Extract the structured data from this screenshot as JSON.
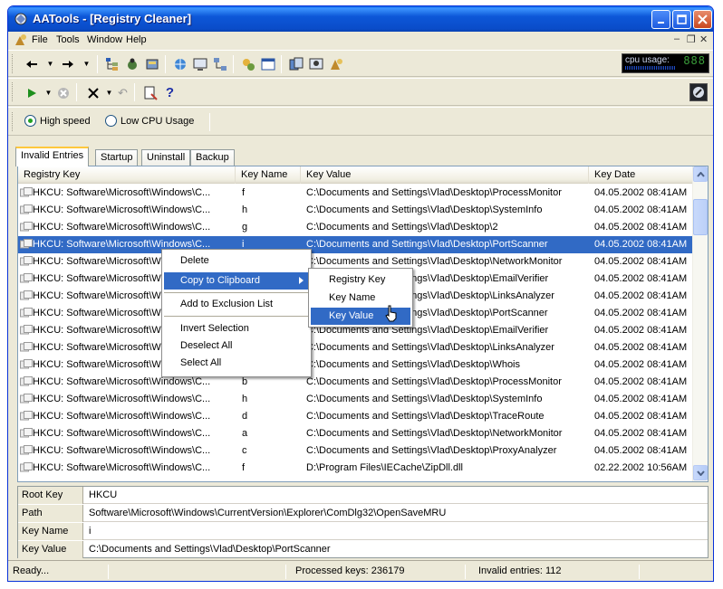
{
  "window": {
    "title": "AATools - [Registry Cleaner]"
  },
  "menu": [
    "File",
    "Tools",
    "Window",
    "Help"
  ],
  "cpu": {
    "label": "cpu usage:",
    "digits": "888"
  },
  "options": {
    "high_speed": "High speed",
    "low_cpu": "Low CPU Usage",
    "selected": "high_speed"
  },
  "tabs": [
    "Invalid Entries",
    "Startup",
    "Uninstall",
    "Backup"
  ],
  "columns": [
    "Registry Key",
    "Key Name",
    "Key Value",
    "Key Date"
  ],
  "rows": [
    {
      "key": "HKCU: Software\\Microsoft\\Windows\\C...",
      "name": "f",
      "value": "C:\\Documents and Settings\\Vlad\\Desktop\\ProcessMonitor",
      "date": "04.05.2002 08:41AM"
    },
    {
      "key": "HKCU: Software\\Microsoft\\Windows\\C...",
      "name": "h",
      "value": "C:\\Documents and Settings\\Vlad\\Desktop\\SystemInfo",
      "date": "04.05.2002 08:41AM"
    },
    {
      "key": "HKCU: Software\\Microsoft\\Windows\\C...",
      "name": "g",
      "value": "C:\\Documents and Settings\\Vlad\\Desktop\\2",
      "date": "04.05.2002 08:41AM"
    },
    {
      "key": "HKCU: Software\\Microsoft\\Windows\\C...",
      "name": "i",
      "value": "C:\\Documents and Settings\\Vlad\\Desktop\\PortScanner",
      "date": "04.05.2002 08:41AM"
    },
    {
      "key": "HKCU: Software\\Microsoft\\Windows\\C...",
      "name": "",
      "value": "C:\\Documents and Settings\\Vlad\\Desktop\\NetworkMonitor",
      "date": "04.05.2002 08:41AM"
    },
    {
      "key": "HKCU: Software\\Microsoft\\Windows\\C...",
      "name": "",
      "value": "C:\\Documents and Settings\\Vlad\\Desktop\\EmailVerifier",
      "date": "04.05.2002 08:41AM"
    },
    {
      "key": "HKCU: Software\\Microsoft\\Windows\\C...",
      "name": "",
      "value": "C:\\Documents and Settings\\Vlad\\Desktop\\LinksAnalyzer",
      "date": "04.05.2002 08:41AM"
    },
    {
      "key": "HKCU: Software\\Microsoft\\Windows\\C...",
      "name": "",
      "value": "C:\\Documents and Settings\\Vlad\\Desktop\\PortScanner",
      "date": "04.05.2002 08:41AM"
    },
    {
      "key": "HKCU: Software\\Microsoft\\Windows\\C...",
      "name": "",
      "value": "C:\\Documents and Settings\\Vlad\\Desktop\\EmailVerifier",
      "date": "04.05.2002 08:41AM"
    },
    {
      "key": "HKCU: Software\\Microsoft\\Windows\\C...",
      "name": "",
      "value": "C:\\Documents and Settings\\Vlad\\Desktop\\LinksAnalyzer",
      "date": "04.05.2002 08:41AM"
    },
    {
      "key": "HKCU: Software\\Microsoft\\Windows\\C...",
      "name": "",
      "value": "C:\\Documents and Settings\\Vlad\\Desktop\\Whois",
      "date": "04.05.2002 08:41AM"
    },
    {
      "key": "HKCU: Software\\Microsoft\\Windows\\C...",
      "name": "b",
      "value": "C:\\Documents and Settings\\Vlad\\Desktop\\ProcessMonitor",
      "date": "04.05.2002 08:41AM"
    },
    {
      "key": "HKCU: Software\\Microsoft\\Windows\\C...",
      "name": "h",
      "value": "C:\\Documents and Settings\\Vlad\\Desktop\\SystemInfo",
      "date": "04.05.2002 08:41AM"
    },
    {
      "key": "HKCU: Software\\Microsoft\\Windows\\C...",
      "name": "d",
      "value": "C:\\Documents and Settings\\Vlad\\Desktop\\TraceRoute",
      "date": "04.05.2002 08:41AM"
    },
    {
      "key": "HKCU: Software\\Microsoft\\Windows\\C...",
      "name": "a",
      "value": "C:\\Documents and Settings\\Vlad\\Desktop\\NetworkMonitor",
      "date": "04.05.2002 08:41AM"
    },
    {
      "key": "HKCU: Software\\Microsoft\\Windows\\C...",
      "name": "c",
      "value": "C:\\Documents and Settings\\Vlad\\Desktop\\ProxyAnalyzer",
      "date": "04.05.2002 08:41AM"
    },
    {
      "key": "HKCU: Software\\Microsoft\\Windows\\C...",
      "name": "f",
      "value": "D:\\Program Files\\IECache\\ZipDll.dll",
      "date": "02.22.2002 10:56AM"
    }
  ],
  "selected_row": 3,
  "context_menu": {
    "items": [
      "Delete",
      "Copy to Clipboard",
      "Add to Exclusion List",
      "Invert Selection",
      "Deselect All",
      "Select All"
    ],
    "highlighted": "Copy to Clipboard",
    "submenu": [
      "Registry Key",
      "Key Name",
      "Key Value"
    ],
    "submenu_highlighted": "Key Value"
  },
  "details": [
    {
      "label": "Root Key",
      "value": "HKCU"
    },
    {
      "label": "Path",
      "value": "Software\\Microsoft\\Windows\\CurrentVersion\\Explorer\\ComDlg32\\OpenSaveMRU"
    },
    {
      "label": "Key Name",
      "value": "i"
    },
    {
      "label": "Key Value",
      "value": "C:\\Documents and Settings\\Vlad\\Desktop\\PortScanner"
    }
  ],
  "status": {
    "ready": "Ready...",
    "processed": "Processed keys: 236179",
    "invalid": "Invalid entries: 112"
  },
  "colors": {
    "title_blue": "#0a4cc9",
    "selection": "#316ac5",
    "window_bg": "#ece9d8"
  }
}
